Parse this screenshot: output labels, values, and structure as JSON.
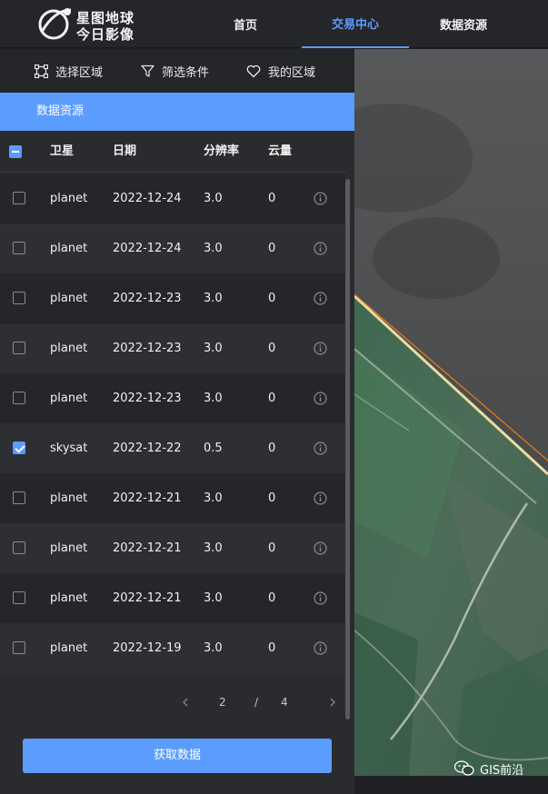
{
  "brand": {
    "line1": "星图地球",
    "line2": "今日影像"
  },
  "nav": [
    {
      "label": "首页",
      "active": false
    },
    {
      "label": "交易中心",
      "active": true
    },
    {
      "label": "数据资源",
      "active": false
    }
  ],
  "toolbar": {
    "select_area": "选择区域",
    "filter": "筛选条件",
    "my_areas": "我的区域"
  },
  "section_title": "数据资源",
  "table": {
    "headers": {
      "satellite": "卫星",
      "date": "日期",
      "resolution": "分辨率",
      "cloud": "云量"
    },
    "rows": [
      {
        "satellite": "planet",
        "date": "2022-12-24",
        "resolution": "3.0",
        "cloud": "0",
        "checked": false
      },
      {
        "satellite": "planet",
        "date": "2022-12-24",
        "resolution": "3.0",
        "cloud": "0",
        "checked": false
      },
      {
        "satellite": "planet",
        "date": "2022-12-23",
        "resolution": "3.0",
        "cloud": "0",
        "checked": false
      },
      {
        "satellite": "planet",
        "date": "2022-12-23",
        "resolution": "3.0",
        "cloud": "0",
        "checked": false
      },
      {
        "satellite": "planet",
        "date": "2022-12-23",
        "resolution": "3.0",
        "cloud": "0",
        "checked": false
      },
      {
        "satellite": "skysat",
        "date": "2022-12-22",
        "resolution": "0.5",
        "cloud": "0",
        "checked": true
      },
      {
        "satellite": "planet",
        "date": "2022-12-21",
        "resolution": "3.0",
        "cloud": "0",
        "checked": false
      },
      {
        "satellite": "planet",
        "date": "2022-12-21",
        "resolution": "3.0",
        "cloud": "0",
        "checked": false
      },
      {
        "satellite": "planet",
        "date": "2022-12-21",
        "resolution": "3.0",
        "cloud": "0",
        "checked": false
      },
      {
        "satellite": "planet",
        "date": "2022-12-19",
        "resolution": "3.0",
        "cloud": "0",
        "checked": false
      }
    ]
  },
  "pagination": {
    "current": "2",
    "separator": "/",
    "total": "4",
    "prev_icon": "chevron-left-icon",
    "next_icon": "chevron-right-icon"
  },
  "fetch_button": "获取数据",
  "watermark": "GIS前沿",
  "colors": {
    "accent": "#5b9cff",
    "panel": "#2a2b2e",
    "topbar": "#25262a",
    "boundary": "#f07a18"
  }
}
